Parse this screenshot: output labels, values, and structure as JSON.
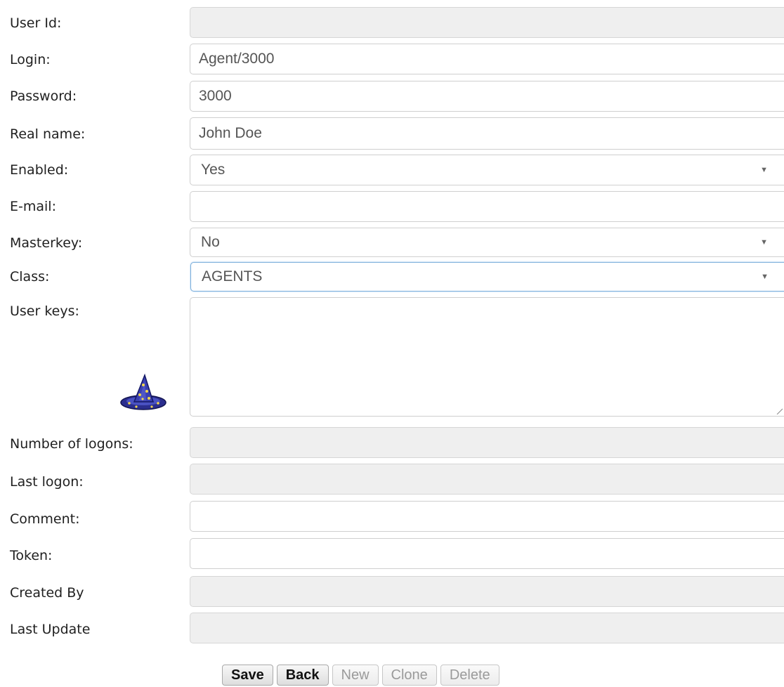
{
  "form": {
    "fields": [
      {
        "label": "User Id:",
        "value": ""
      },
      {
        "label": "Login:",
        "value": "Agent/3000"
      },
      {
        "label": "Password:",
        "value": "3000"
      },
      {
        "label": "Real name:",
        "value": "John Doe"
      },
      {
        "label": "Enabled:",
        "value": "Yes"
      },
      {
        "label": "E-mail:",
        "value": ""
      },
      {
        "label": "Masterkey:",
        "value": "No"
      },
      {
        "label": "Class:",
        "value": "AGENTS"
      },
      {
        "label": "User keys:",
        "value": ""
      },
      {
        "label": "Number of logons:",
        "value": ""
      },
      {
        "label": "Last logon:",
        "value": ""
      },
      {
        "label": "Comment:",
        "value": ""
      },
      {
        "label": "Token:",
        "value": ""
      },
      {
        "label": "Created By",
        "value": ""
      },
      {
        "label": "Last Update",
        "value": ""
      }
    ]
  },
  "buttons": {
    "save": "Save",
    "back": "Back",
    "new": "New",
    "clone": "Clone",
    "delete": "Delete"
  },
  "icons": {
    "wizard": "wizard-hat-icon",
    "dropdown": "chevron-down-icon"
  },
  "colors": {
    "focus_border": "#7aaedb",
    "disabled_bg": "#efefef"
  }
}
